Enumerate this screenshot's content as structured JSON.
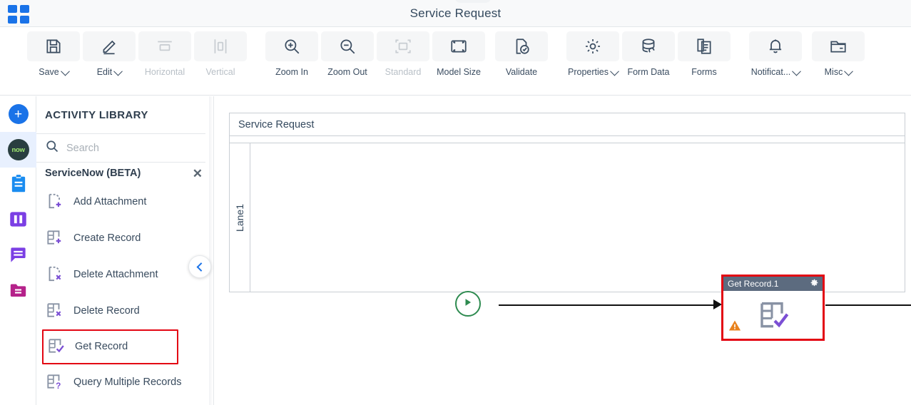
{
  "window": {
    "title": "Service Request",
    "app_grid_icon": "apps-grid-icon"
  },
  "toolbar": {
    "items": [
      {
        "label": "Save",
        "icon": "save-icon",
        "dropdown": true,
        "disabled": false
      },
      {
        "label": "Edit",
        "icon": "pencil-icon",
        "dropdown": true,
        "disabled": false
      },
      {
        "label": "Horizontal",
        "icon": "horizontal-icon",
        "dropdown": false,
        "disabled": true
      },
      {
        "label": "Vertical",
        "icon": "vertical-icon",
        "dropdown": false,
        "disabled": true
      },
      {
        "label": "Zoom In",
        "icon": "zoom-in-icon",
        "dropdown": false,
        "disabled": false
      },
      {
        "label": "Zoom Out",
        "icon": "zoom-out-icon",
        "dropdown": false,
        "disabled": false
      },
      {
        "label": "Standard",
        "icon": "standard-size-icon",
        "dropdown": false,
        "disabled": true
      },
      {
        "label": "Model Size",
        "icon": "model-size-icon",
        "dropdown": false,
        "disabled": false
      },
      {
        "label": "Validate",
        "icon": "validate-icon",
        "dropdown": false,
        "disabled": false
      },
      {
        "label": "Properties",
        "icon": "gear-icon",
        "dropdown": true,
        "disabled": false
      },
      {
        "label": "Form Data",
        "icon": "database-icon",
        "dropdown": false,
        "disabled": false
      },
      {
        "label": "Forms",
        "icon": "forms-icon",
        "dropdown": false,
        "disabled": false
      },
      {
        "label": "Notificat...",
        "icon": "bell-icon",
        "dropdown": true,
        "disabled": false
      },
      {
        "label": "Misc",
        "icon": "folder-icon",
        "dropdown": true,
        "disabled": false
      }
    ]
  },
  "rail": {
    "items": [
      {
        "name": "add-button",
        "icon": "plus-circle-icon",
        "selected": false
      },
      {
        "name": "servicenow-button",
        "icon": "now-logo-icon",
        "selected": true,
        "text": "now"
      },
      {
        "name": "clipboard-button",
        "icon": "clipboard-icon",
        "selected": false
      },
      {
        "name": "columns-button",
        "icon": "columns-icon",
        "selected": false
      },
      {
        "name": "comments-button",
        "icon": "speech-bubble-icon",
        "selected": false
      },
      {
        "name": "folder-button",
        "icon": "folder-lines-icon",
        "selected": false
      }
    ]
  },
  "panel": {
    "title": "ACTIVITY LIBRARY",
    "search": {
      "placeholder": "Search",
      "value": "",
      "icon": "search-icon"
    },
    "group": {
      "label": "ServiceNow (BETA)",
      "close_icon": "close-icon"
    },
    "activities": [
      {
        "label": "Add Attachment",
        "icon": "add-attachment-icon",
        "highlighted": false
      },
      {
        "label": "Create Record",
        "icon": "create-record-icon",
        "highlighted": false
      },
      {
        "label": "Delete Attachment",
        "icon": "delete-attachment-icon",
        "highlighted": false
      },
      {
        "label": "Delete Record",
        "icon": "delete-record-icon",
        "highlighted": false
      },
      {
        "label": "Get Record",
        "icon": "get-record-icon",
        "highlighted": true
      },
      {
        "label": "Query Multiple Records",
        "icon": "query-records-icon",
        "highlighted": false
      }
    ],
    "collapse_icon": "chevron-left-icon"
  },
  "canvas": {
    "pool_title": "Service Request",
    "lane_label": "Lane1",
    "start_node": {
      "name": "start-event",
      "icon": "play-icon"
    },
    "end_node": {
      "name": "end-event",
      "icon": "stop-square-icon"
    },
    "task": {
      "title": "Get Record.1",
      "gear_icon": "gear-icon",
      "body_icon": "get-record-icon",
      "warning_icon": "warning-triangle-icon",
      "selected": true
    }
  },
  "colors": {
    "accent_blue": "#1a73e8",
    "selection_red": "#e30613",
    "start_green": "#2e8b50",
    "end_red": "#c0392b",
    "task_header": "#5c6b7f",
    "warning_orange": "#e8821e",
    "icon_purple": "#7b4fd4",
    "icon_gray": "#8892a4"
  }
}
